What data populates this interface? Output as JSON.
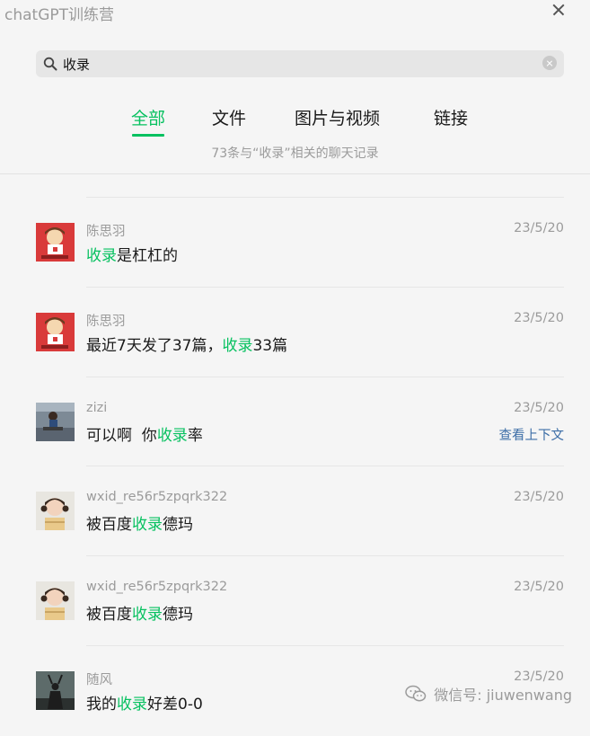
{
  "window": {
    "title": "chatGPT训练营"
  },
  "search": {
    "query": "收录"
  },
  "tabs": [
    {
      "label": "全部",
      "active": true
    },
    {
      "label": "文件",
      "active": false
    },
    {
      "label": "图片与视频",
      "active": false
    },
    {
      "label": "链接",
      "active": false
    }
  ],
  "summary": "73条与“收录”相关的聊天记录",
  "colors": {
    "accent": "#07c160",
    "link": "#3d6ea7",
    "muted": "#9b9b9b"
  },
  "results": [
    {
      "sender": "陈思羽",
      "date": "23/5/20",
      "before": "",
      "highlight": "收录",
      "after": "是杠杠的",
      "avatar": "red-pixel-avatar"
    },
    {
      "sender": "陈思羽",
      "date": "23/5/20",
      "before": "最近7天发了37篇，",
      "highlight": "收录",
      "after": "33篇",
      "avatar": "red-pixel-avatar"
    },
    {
      "sender": "zizi",
      "date": "23/5/20",
      "before": "可以啊  你",
      "highlight": "收录",
      "after": "率",
      "avatar": "child-photo-avatar",
      "context_link": "查看上下文"
    },
    {
      "sender": "wxid_re56r5zpqrk322",
      "date": "23/5/20",
      "before": "被百度",
      "highlight": "收录",
      "after": "德玛",
      "avatar": "girl-photo-avatar"
    },
    {
      "sender": "wxid_re56r5zpqrk322",
      "date": "23/5/20",
      "before": "被百度",
      "highlight": "收录",
      "after": "德玛",
      "avatar": "girl-photo-avatar"
    },
    {
      "sender": "随风",
      "date": "23/5/20",
      "before": "我的",
      "highlight": "收录",
      "after": "好差0-0",
      "avatar": "dark-figure-avatar"
    }
  ],
  "watermark": {
    "text": "微信号: jiuwenwang"
  }
}
